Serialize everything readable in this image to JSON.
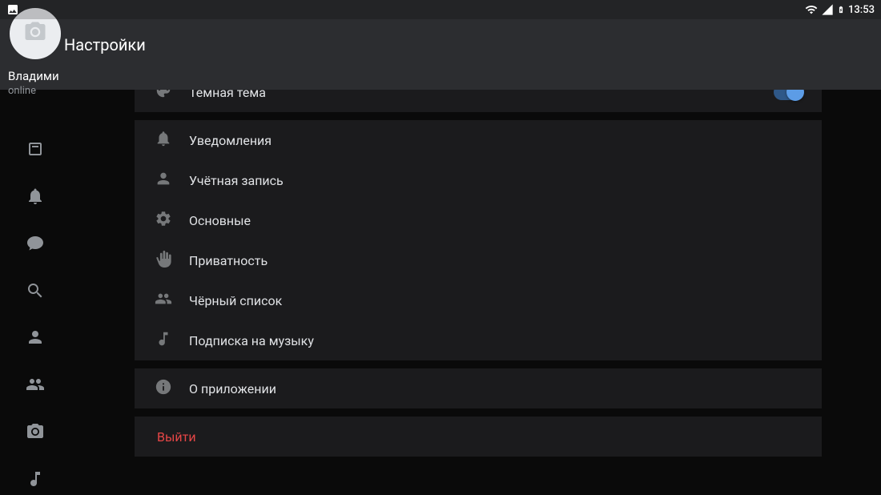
{
  "statusbar": {
    "time": "13:53"
  },
  "appbar": {
    "title": "Настройки"
  },
  "profile": {
    "name": "Владими",
    "status": "online"
  },
  "settings": {
    "dark_theme": {
      "label": "Тёмная тема",
      "on": true
    },
    "notifications": "Уведомления",
    "account": "Учётная запись",
    "general": "Основные",
    "privacy": "Приватность",
    "blacklist": "Чёрный список",
    "music_sub": "Подписка на музыку",
    "about": "О приложении",
    "logout": "Выйти"
  }
}
